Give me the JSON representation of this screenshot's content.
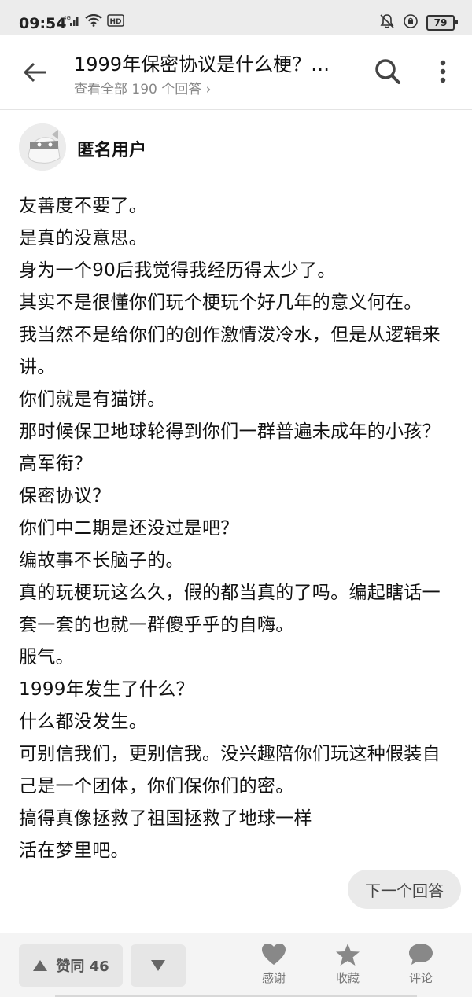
{
  "status_bar": {
    "time": "09:54",
    "network": "4G",
    "hd": "HD",
    "battery": "79"
  },
  "header": {
    "title": "1999年保密协议是什么梗？…",
    "subtitle": "查看全部 190 个回答 ›",
    "icons": [
      "back-arrow-icon",
      "search-icon",
      "more-vertical-icon"
    ]
  },
  "author": {
    "name": "匿名用户"
  },
  "answer": {
    "paragraphs": [
      "友善度不要了。",
      "是真的没意思。",
      "身为一个90后我觉得我经历得太少了。",
      "其实不是很懂你们玩个梗玩个好几年的意义何在。",
      "我当然不是给你们的创作激情泼冷水，但是从逻辑来讲。",
      "你们就是有猫饼。",
      "那时候保卫地球轮得到你们一群普遍未成年的小孩？",
      "高军衔？",
      "保密协议？",
      "你们中二期是还没过是吧？",
      "编故事不长脑子的。",
      "真的玩梗玩这么久，假的都当真的了吗。编起瞎话一套一套的也就一群傻乎乎的自嗨。",
      "服气。",
      "1999年发生了什么？",
      "什么都没发生。",
      "可别信我们，更别信我。没兴趣陪你们玩这种假装自己是一个团体，你们保你们的密。",
      "搞得真像拯救了祖国拯救了地球一样",
      "活在梦里吧。"
    ]
  },
  "next_answer_label": "下一个回答",
  "bottom_bar": {
    "upvote_label": "赞同 46",
    "thanks_label": "感谢",
    "collect_label": "收藏",
    "comment_label": "评论"
  }
}
